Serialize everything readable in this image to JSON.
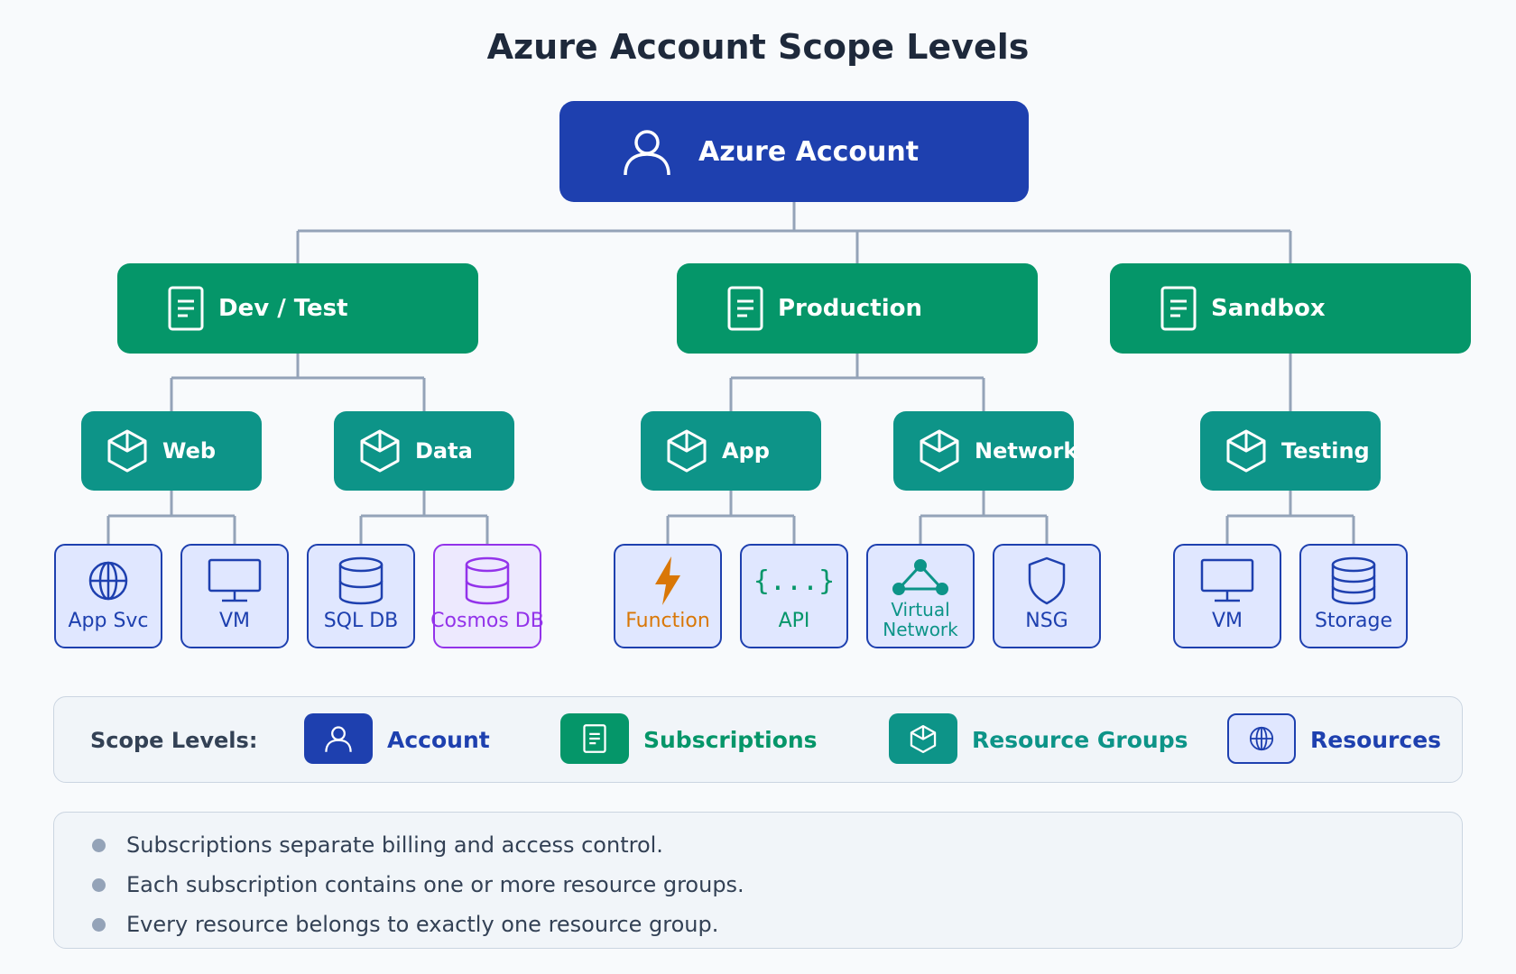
{
  "title": "Azure Account Scope Levels",
  "account": {
    "label": "Azure Account",
    "icon": "user-icon"
  },
  "subscriptions": [
    {
      "label": "Dev / Test",
      "icon": "document-icon"
    },
    {
      "label": "Production",
      "icon": "document-icon"
    },
    {
      "label": "Sandbox",
      "icon": "document-icon"
    }
  ],
  "resource_groups": [
    {
      "label": "Web",
      "icon": "cube-icon"
    },
    {
      "label": "Data",
      "icon": "cube-icon"
    },
    {
      "label": "App",
      "icon": "cube-icon"
    },
    {
      "label": "Network",
      "icon": "cube-icon"
    },
    {
      "label": "Testing",
      "icon": "cube-icon"
    }
  ],
  "resources": [
    {
      "label": "App Svc",
      "icon": "globe-icon"
    },
    {
      "label": "VM",
      "icon": "monitor-icon"
    },
    {
      "label": "SQL DB",
      "icon": "database-icon"
    },
    {
      "label": "Cosmos DB",
      "icon": "database-icon",
      "color": "#9333ea"
    },
    {
      "label": "Function",
      "icon": "lightning-icon",
      "color": "#d97706"
    },
    {
      "label": "API",
      "icon": "braces-icon",
      "glyph": "{...}",
      "color": "#059669"
    },
    {
      "label": "Virtual Network",
      "icon": "network-icon",
      "color": "#0d9488"
    },
    {
      "label": "NSG",
      "icon": "shield-icon"
    },
    {
      "label": "VM",
      "icon": "monitor-icon"
    },
    {
      "label": "Storage",
      "icon": "storage-icon"
    }
  ],
  "legend": {
    "heading": "Scope Levels:",
    "items": [
      {
        "label": "Account",
        "icon": "user-icon",
        "color": "#1e40af"
      },
      {
        "label": "Subscriptions",
        "icon": "document-icon",
        "color": "#059669"
      },
      {
        "label": "Resource Groups",
        "icon": "cube-icon",
        "color": "#0d9488"
      },
      {
        "label": "Resources",
        "icon": "globe-icon",
        "color": "#1e40af"
      }
    ]
  },
  "notes": [
    "Subscriptions separate billing and access control.",
    "Each subscription contains one or more resource groups.",
    "Every resource belongs to exactly one resource group."
  ],
  "colors": {
    "account": "#1e40af",
    "subscription": "#059669",
    "resource_group": "#0d9488",
    "resource_fill": "#e0e7ff",
    "connector": "#94a3b8"
  }
}
